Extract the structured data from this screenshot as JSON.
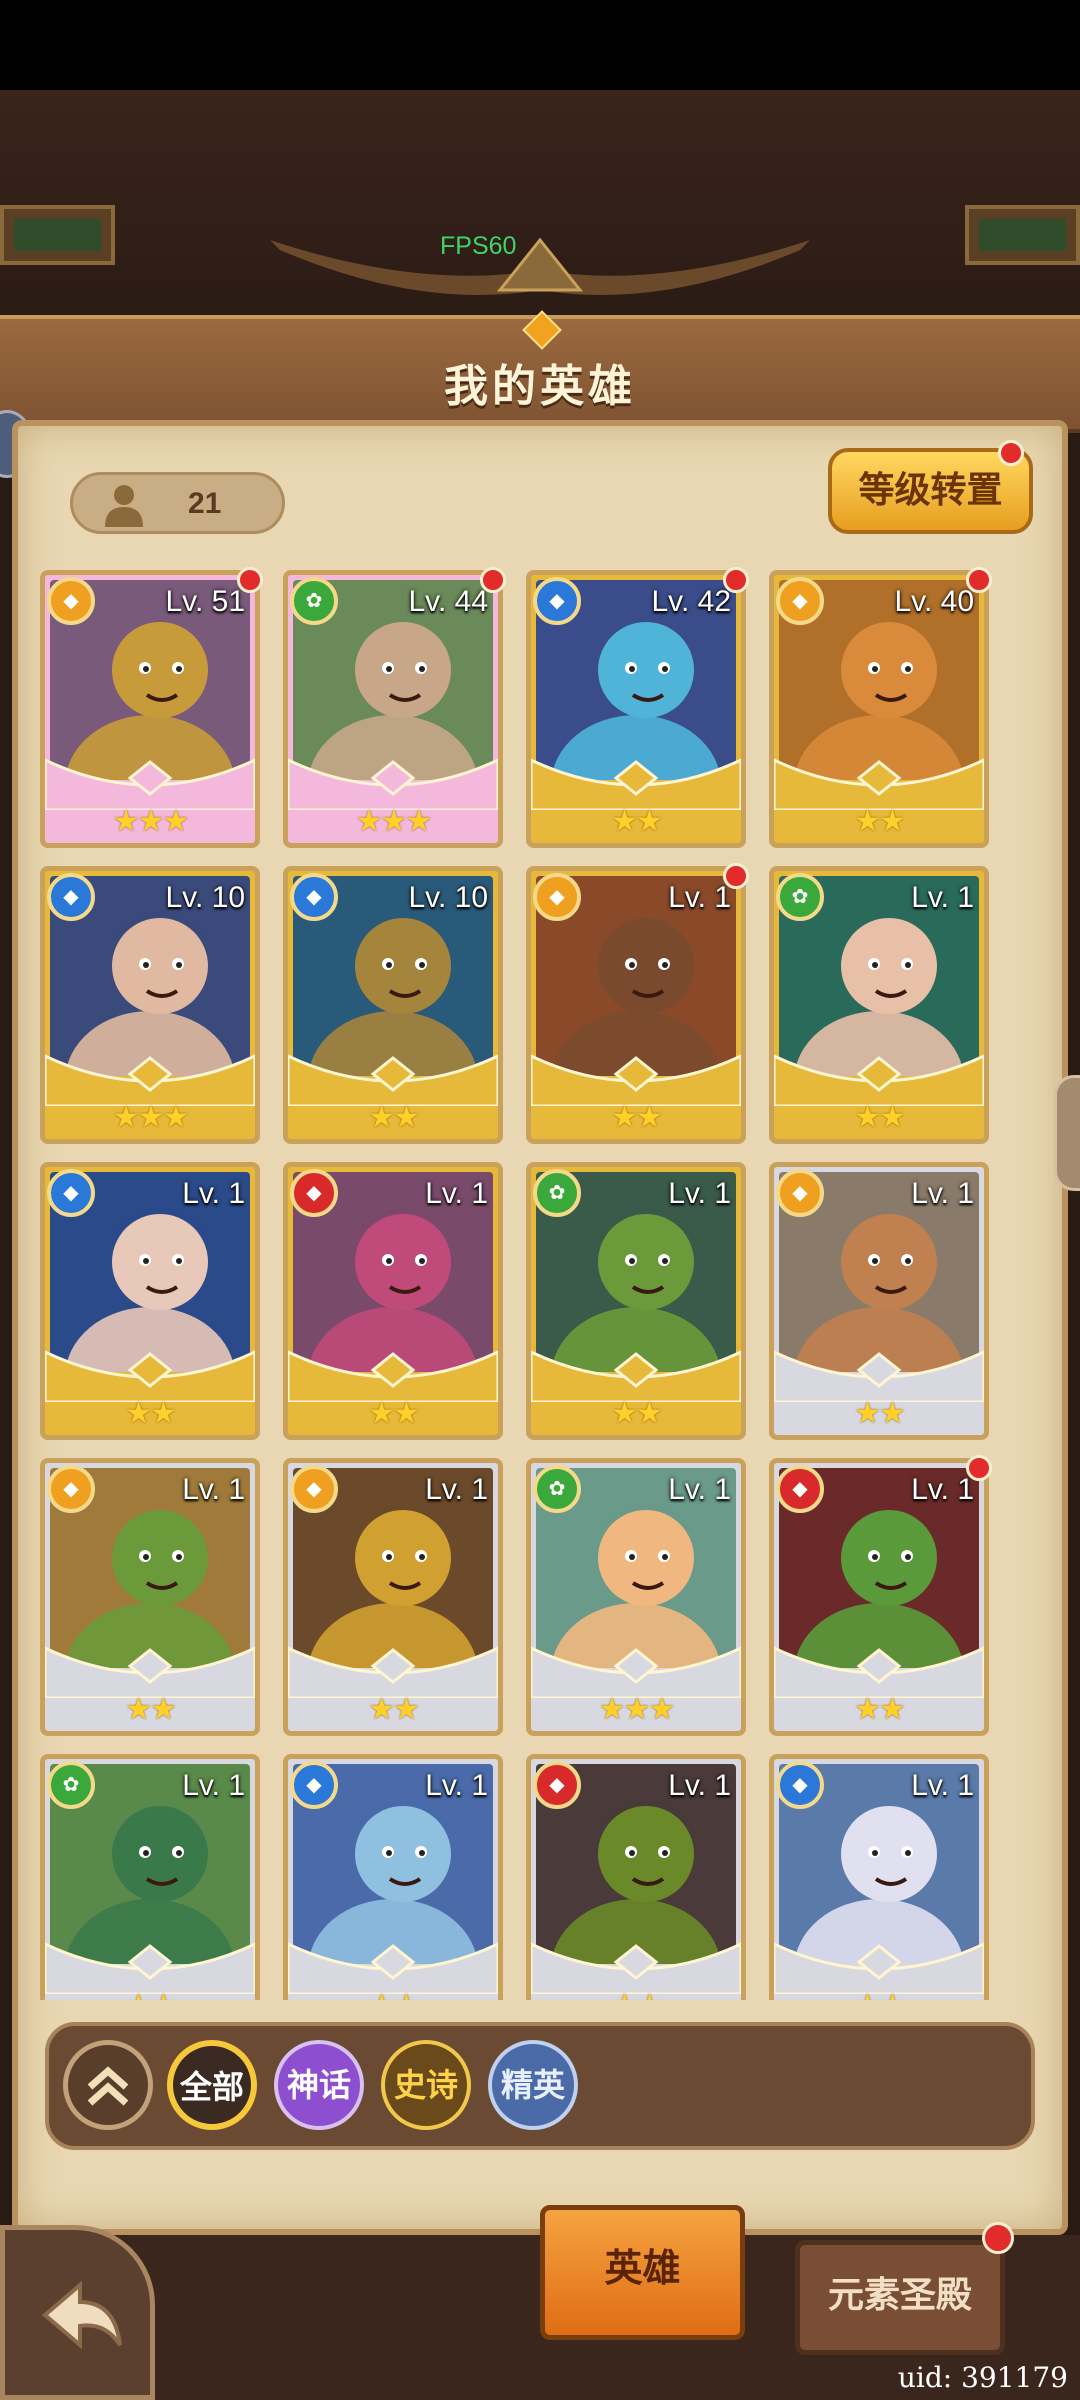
{
  "header": {
    "fps": "FPS60",
    "title": "我的英雄"
  },
  "hero_count": "21",
  "level_transfer_label": "等级转置",
  "heroes": [
    {
      "level": "Lv. 51",
      "element": "yellow",
      "stars": "★★★",
      "rarity": "mythic",
      "dot": true,
      "palette": [
        "#7a5a7a",
        "#c89b3a"
      ]
    },
    {
      "level": "Lv. 44",
      "element": "green",
      "stars": "★★★",
      "rarity": "mythic",
      "dot": true,
      "palette": [
        "#6a8a5a",
        "#c7a787"
      ]
    },
    {
      "level": "Lv. 42",
      "element": "blue",
      "stars": "★★",
      "rarity": "epic",
      "dot": true,
      "palette": [
        "#3a4c8a",
        "#4fb4d8"
      ]
    },
    {
      "level": "Lv. 40",
      "element": "yellow",
      "stars": "★★",
      "rarity": "epic",
      "dot": true,
      "palette": [
        "#b0702a",
        "#d98a3a"
      ]
    },
    {
      "level": "Lv. 10",
      "element": "blue",
      "stars": "★★★",
      "rarity": "epic",
      "dot": false,
      "palette": [
        "#3a4a7a",
        "#e0b9a0"
      ]
    },
    {
      "level": "Lv. 10",
      "element": "blue",
      "stars": "★★",
      "rarity": "epic",
      "dot": false,
      "palette": [
        "#2a5a7a",
        "#a5843c"
      ]
    },
    {
      "level": "Lv. 1",
      "element": "yellow",
      "stars": "★★",
      "rarity": "epic",
      "dot": true,
      "palette": [
        "#8a4a2a",
        "#7a4a2e"
      ]
    },
    {
      "level": "Lv. 1",
      "element": "green",
      "stars": "★★",
      "rarity": "epic",
      "dot": false,
      "palette": [
        "#2a6a5a",
        "#e8c0a8"
      ]
    },
    {
      "level": "Lv. 1",
      "element": "blue",
      "stars": "★★",
      "rarity": "epic",
      "dot": false,
      "palette": [
        "#2a4a8a",
        "#e8c8b8"
      ]
    },
    {
      "level": "Lv. 1",
      "element": "red",
      "stars": "★★",
      "rarity": "epic",
      "dot": false,
      "palette": [
        "#7a4a6a",
        "#c04a7a"
      ]
    },
    {
      "level": "Lv. 1",
      "element": "green",
      "stars": "★★",
      "rarity": "epic",
      "dot": false,
      "palette": [
        "#3a5a4a",
        "#6a9a3a"
      ]
    },
    {
      "level": "Lv. 1",
      "element": "yellow",
      "stars": "★★",
      "rarity": "elite",
      "dot": false,
      "palette": [
        "#8a7a6a",
        "#c08050"
      ]
    },
    {
      "level": "Lv. 1",
      "element": "yellow",
      "stars": "★★",
      "rarity": "elite",
      "dot": false,
      "palette": [
        "#a07a3a",
        "#6a9a3a"
      ]
    },
    {
      "level": "Lv. 1",
      "element": "yellow",
      "stars": "★★",
      "rarity": "elite",
      "dot": false,
      "palette": [
        "#6a4a2a",
        "#d0a030"
      ]
    },
    {
      "level": "Lv. 1",
      "element": "green",
      "stars": "★★★",
      "rarity": "elite",
      "dot": false,
      "palette": [
        "#6a9a8a",
        "#f0b880"
      ]
    },
    {
      "level": "Lv. 1",
      "element": "red",
      "stars": "★★",
      "rarity": "elite",
      "dot": true,
      "palette": [
        "#6a2a2a",
        "#5a9a3a"
      ]
    },
    {
      "level": "Lv. 1",
      "element": "green",
      "stars": "★★",
      "rarity": "elite",
      "dot": false,
      "palette": [
        "#5a8a4a",
        "#3a7a4a"
      ]
    },
    {
      "level": "Lv. 1",
      "element": "blue",
      "stars": "★★",
      "rarity": "elite",
      "dot": false,
      "palette": [
        "#4a6aaa",
        "#90c0e0"
      ]
    },
    {
      "level": "Lv. 1",
      "element": "red",
      "stars": "★★",
      "rarity": "elite",
      "dot": false,
      "palette": [
        "#4a3a3a",
        "#6a8a2a"
      ]
    },
    {
      "level": "Lv. 1",
      "element": "blue",
      "stars": "★★",
      "rarity": "elite",
      "dot": false,
      "palette": [
        "#5a7aaa",
        "#e0e0f0"
      ]
    }
  ],
  "filters": {
    "all": "全部",
    "mythic": "神话",
    "epic": "史诗",
    "elite": "精英"
  },
  "tabs": {
    "hero": "英雄",
    "element_temple": "元素圣殿"
  },
  "uid": "uid: 391179",
  "colors": {
    "element_yellow": "#f0a020",
    "element_green": "#3aa83a",
    "element_blue": "#2a78d8",
    "element_red": "#d82a2a",
    "mythic_frame": "#f3b8dc",
    "epic_frame": "#e6b93a",
    "elite_frame": "#d8d8e0"
  }
}
